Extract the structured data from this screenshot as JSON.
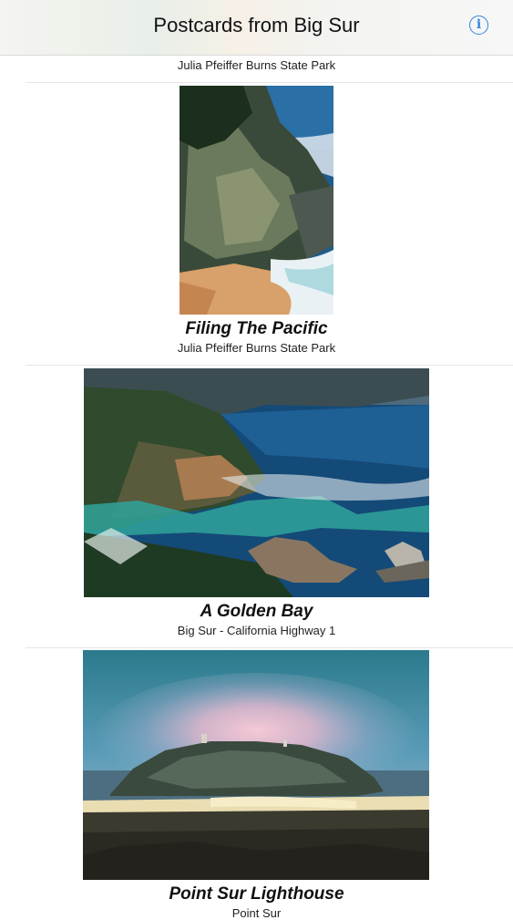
{
  "navbar": {
    "title": "Postcards from Big Sur",
    "info_icon": "info-circle-icon",
    "accent": "#2f86e0"
  },
  "postcards": [
    {
      "title": "",
      "location": "Julia Pfeiffer Burns State Park"
    },
    {
      "title": "Filing The Pacific",
      "location": "Julia Pfeiffer Burns State Park"
    },
    {
      "title": "A Golden Bay",
      "location": "Big Sur - California Highway 1"
    },
    {
      "title": "Point Sur Lighthouse",
      "location": "Point Sur"
    }
  ]
}
